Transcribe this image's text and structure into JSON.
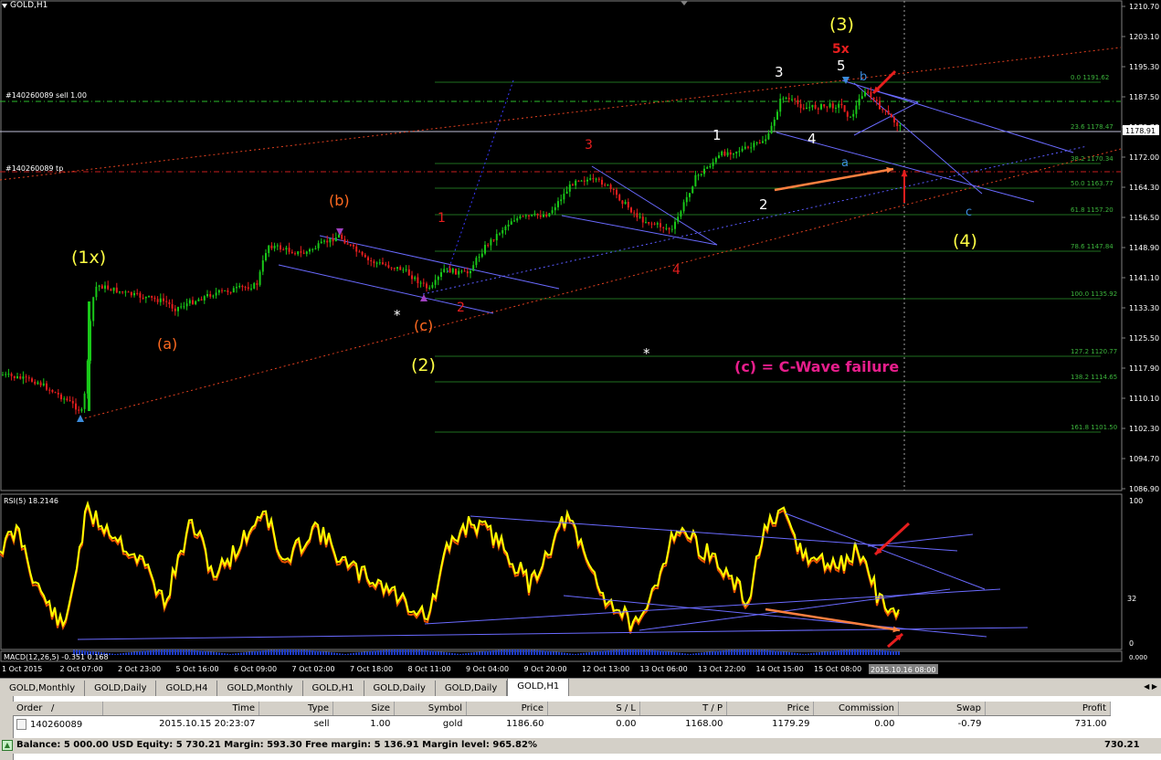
{
  "chart": {
    "symbol_title": "GOLD,H1",
    "main_chart": {
      "price_labels": [
        "1210.70",
        "1203.10",
        "1195.30",
        "1187.50",
        "1179.70",
        "1172.00",
        "1164.30",
        "1156.50",
        "1148.90",
        "1141.10",
        "1133.30",
        "1125.50",
        "1117.90",
        "1110.10",
        "1102.30",
        "1094.70",
        "1086.90"
      ],
      "current_price": "1178.91",
      "date_labels": [
        "1 Oct 2015",
        "2 Oct 07:00",
        "2 Oct 23:00",
        "5 Oct 16:00",
        "6 Oct 09:00",
        "7 Oct 02:00",
        "7 Oct 18:00",
        "8 Oct 11:00",
        "9 Oct 04:00",
        "9 Oct 20:00",
        "12 Oct 13:00",
        "13 Oct 06:00",
        "13 Oct 22:00",
        "14 Oct 15:00",
        "15 Oct 08:00"
      ],
      "date_current": "2015.10.16 08:00",
      "trade_labels": {
        "sell": "#140260089 sell 1.00",
        "tp": "#140260089 tp"
      },
      "fib_levels": [
        "0.0  1191.62",
        "23.6  1178.47",
        "38.2  1170.34",
        "50.0  1163.77",
        "61.8  1157.20",
        "78.6  1147.84",
        "100.0  1135.92",
        "127.2  1120.77",
        "138.2  1114.65",
        "161.8  1101.50"
      ],
      "wave_labels": {
        "w3_major": "(3)",
        "w5x": "5x",
        "w3": "3",
        "w5": "5",
        "wb": "b",
        "w1w": "1",
        "w4w": "4",
        "wa": "a",
        "w2w": "2",
        "wc": "c",
        "w4_major": "(4)",
        "r3": "3",
        "r1": "1",
        "r2": "2",
        "r4": "4",
        "b_paren": "(b)",
        "c_paren": "(c)",
        "a_paren": "(a)",
        "w1x": "(1x)",
        "w2_major": "(2)",
        "star": "*"
      },
      "annotation": "(c) = C-Wave failure"
    },
    "rsi": {
      "title": "RSI(5) 18.2146",
      "scale": [
        "100",
        "32",
        "0"
      ]
    },
    "macd": {
      "title": "MACD(12,26,5) -0.351 0.168",
      "scale": "0.000"
    },
    "colors": {
      "bull": "#19c819",
      "bear": "#e61e1e",
      "wave_yellow": "#ffff44",
      "wave_orange": "#ff6a20",
      "annot": "#e81e8c",
      "rsi": "#ffff00",
      "rsi_sig": "#e65000",
      "trend": "#6a6aff"
    }
  },
  "tabs": {
    "items": [
      "GOLD,Monthly",
      "GOLD,Daily",
      "GOLD,H4",
      "GOLD,Monthly",
      "GOLD,H1",
      "GOLD,Daily",
      "GOLD,Daily",
      "GOLD,H1"
    ],
    "active_index": 7
  },
  "terminal": {
    "columns": {
      "order": "Order",
      "sort": "/",
      "time": "Time",
      "type": "Type",
      "size": "Size",
      "symbol": "Symbol",
      "price": "Price",
      "sl": "S / L",
      "tp": "T / P",
      "price2": "Price",
      "commission": "Commission",
      "swap": "Swap",
      "profit": "Profit"
    },
    "row": {
      "order": "140260089",
      "time": "2015.10.15 20:23:07",
      "type": "sell",
      "size": "1.00",
      "symbol": "gold",
      "price": "1186.60",
      "sl": "0.00",
      "tp": "1168.00",
      "price2": "1179.29",
      "commission": "0.00",
      "swap": "-0.79",
      "profit": "731.00"
    },
    "balance_line": "Balance: 5 000.00 USD  Equity: 5 730.21  Margin: 593.30  Free margin: 5 136.91  Margin level: 965.82%",
    "balance_total": "730.21"
  }
}
